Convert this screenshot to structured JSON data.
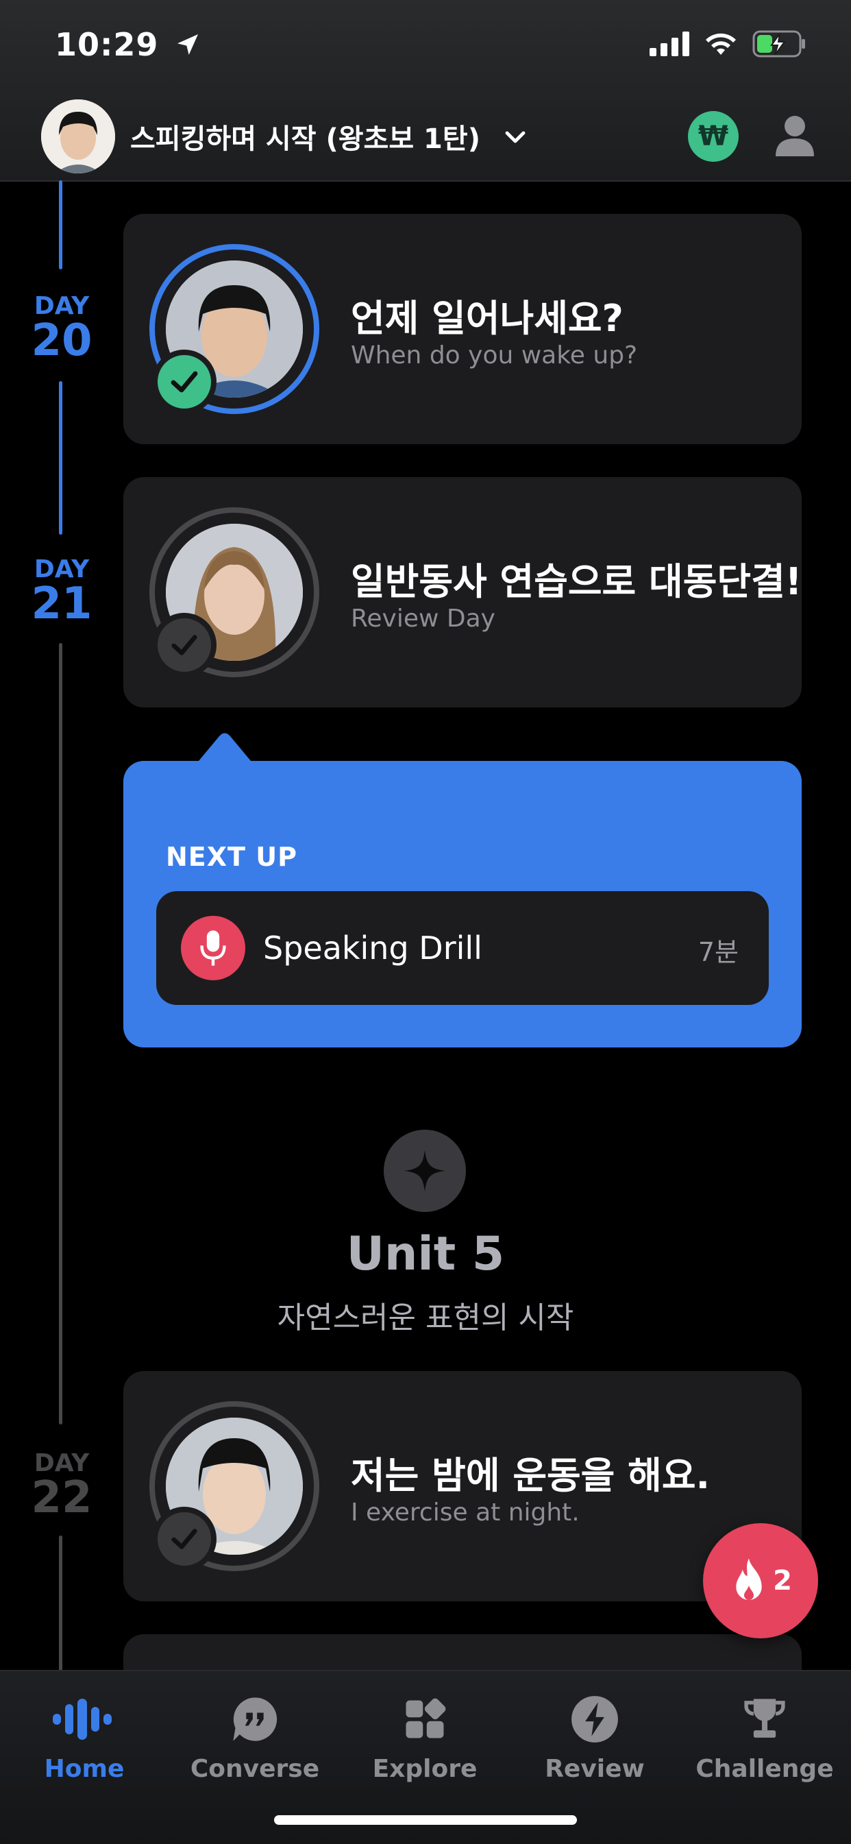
{
  "status_bar": {
    "time": "10:29"
  },
  "header": {
    "course_title": "스피킹하며 시작 (왕초보 1탄)",
    "coin_symbol": "₩"
  },
  "timeline": [
    {
      "day_label": "DAY",
      "day_number": "20",
      "title": "언제 일어나세요?",
      "subtitle": "When do you wake up?",
      "completed": true
    },
    {
      "day_label": "DAY",
      "day_number": "21",
      "title": "일반동사 연습으로 대동단결!",
      "subtitle": "Review Day",
      "completed": false
    },
    {
      "day_label": "DAY",
      "day_number": "22",
      "title": "저는 밤에 운동을 해요.",
      "subtitle": "I exercise at night.",
      "completed": false
    }
  ],
  "next_up": {
    "label": "NEXT UP",
    "activity": "Speaking Drill",
    "duration": "7분"
  },
  "unit": {
    "title": "Unit 5",
    "subtitle": "자연스러운 표현의 시작"
  },
  "streak": {
    "count": "2"
  },
  "tabs": [
    {
      "label": "Home",
      "icon": "waveform-icon",
      "active": true
    },
    {
      "label": "Converse",
      "icon": "quote-bubble-icon",
      "active": false
    },
    {
      "label": "Explore",
      "icon": "grid-icon",
      "active": false
    },
    {
      "label": "Review",
      "icon": "lightning-icon",
      "active": false
    },
    {
      "label": "Challenge",
      "icon": "trophy-icon",
      "active": false
    }
  ],
  "colors": {
    "accent": "#3a7de9",
    "success": "#3fbf8a",
    "streak": "#e6435e",
    "card": "#1c1c1e"
  }
}
